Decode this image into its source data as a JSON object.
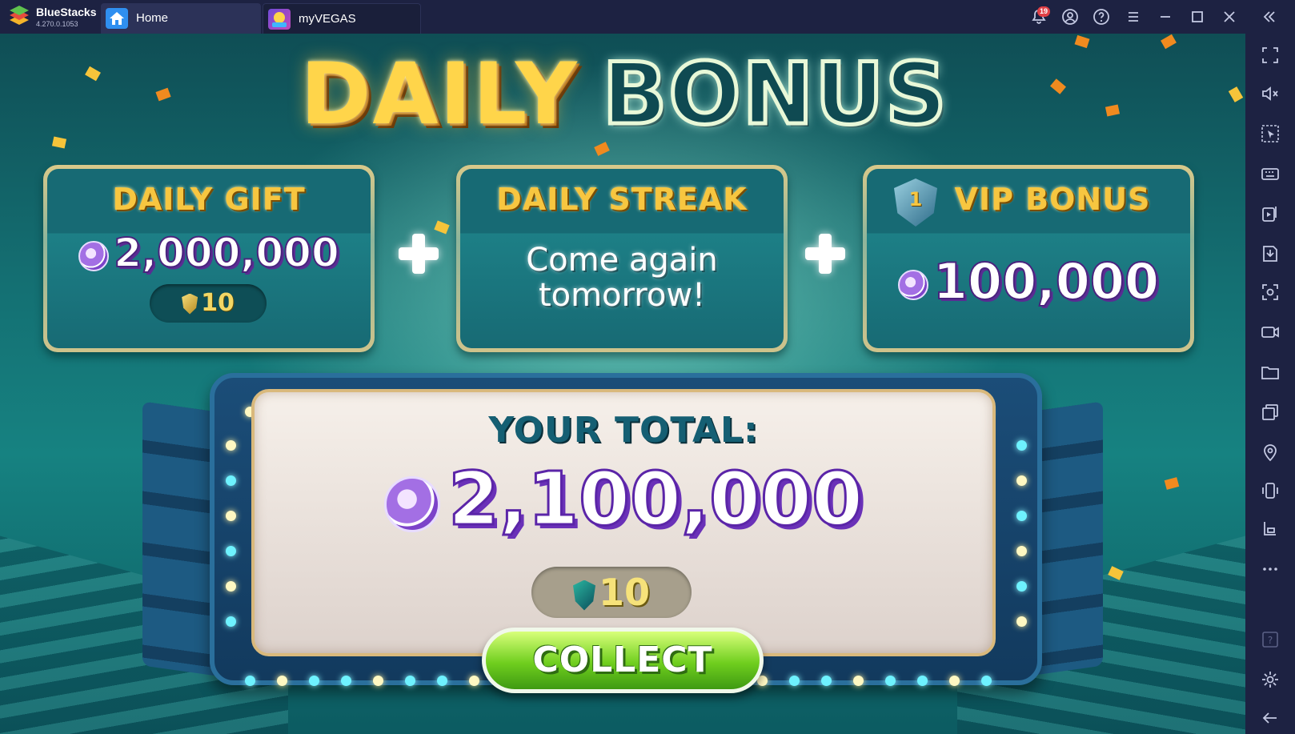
{
  "app": {
    "name": "BlueStacks",
    "version": "4.270.0.1053"
  },
  "tabs": [
    {
      "label": "Home"
    },
    {
      "label": "myVEGAS"
    }
  ],
  "titlebar": {
    "notification_count": "19",
    "icons": [
      "bell-icon",
      "account-icon",
      "help-icon",
      "menu-icon",
      "minimize-icon",
      "maximize-icon",
      "close-icon",
      "collapse-sidebar-icon"
    ]
  },
  "sidebar": {
    "icons": [
      "fullscreen-icon",
      "mute-icon",
      "pointer-icon",
      "keyboard-icon",
      "media-icon",
      "apk-install-icon",
      "screenshot-icon",
      "record-icon",
      "folder-icon",
      "multi-instance-icon",
      "location-icon",
      "shake-icon",
      "eco-mode-icon",
      "more-icon",
      "help-icon",
      "settings-icon",
      "back-icon"
    ]
  },
  "game": {
    "headline": {
      "word1": "DAILY",
      "word2": "BONUS"
    },
    "daily_gift": {
      "title": "DAILY GIFT",
      "chips": "2,000,000",
      "loyalty": "10"
    },
    "daily_streak": {
      "title": "DAILY STREAK",
      "message_line1": "Come again",
      "message_line2": "tomorrow!"
    },
    "vip_bonus": {
      "tier": "1",
      "title": "VIP BONUS",
      "chips": "100,000"
    },
    "total": {
      "label": "YOUR TOTAL:",
      "chips": "2,100,000",
      "loyalty": "10"
    },
    "collect_label": "COLLECT",
    "colors": {
      "gold": "#f7c640",
      "chip_purple": "#5b25a8",
      "collect_green": "#6fce1e",
      "teal_bg": "#146f72"
    }
  }
}
